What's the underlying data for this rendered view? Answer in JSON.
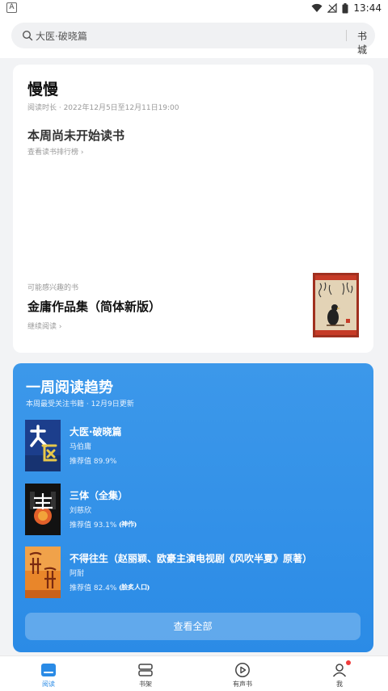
{
  "status_bar": {
    "time": "13:44",
    "left_indicator": "A"
  },
  "search": {
    "placeholder_text": "大医·破晓篇",
    "bookstore_label": "书城"
  },
  "profile": {
    "name": "慢慢",
    "reading_period": "阅读时长 · 2022年12月5日至12月11日19:00",
    "week_status": "本周尚未开始读书",
    "rank_link": "查看读书排行榜 ›"
  },
  "suggestion": {
    "label": "可能感兴趣的书",
    "title": "金庸作品集（简体新版）",
    "continue_label": "继续阅读 ›"
  },
  "trend": {
    "title": "一周阅读趋势",
    "subtitle": "本周最受关注书籍 · 12月9日更新",
    "books": [
      {
        "title": "大医·破晓篇",
        "author": "马伯庸",
        "score": "推荐值 89.9%",
        "badge": ""
      },
      {
        "title": "三体（全集）",
        "author": "刘慈欣",
        "score": "推荐值 93.1%",
        "badge": "神作"
      },
      {
        "title": "不得往生（赵丽颖、欧豪主演电视剧《风吹半夏》原著）",
        "author": "阿耐",
        "score": "推荐值 82.4%",
        "badge": "脍炙人口"
      }
    ],
    "view_all_label": "查看全部"
  },
  "nav": {
    "items": [
      {
        "label": "阅读",
        "active": true
      },
      {
        "label": "书架",
        "active": false
      },
      {
        "label": "有声书",
        "active": false
      },
      {
        "label": "我",
        "active": false
      }
    ]
  },
  "colors": {
    "accent": "#2a8be6",
    "card_blue": "#3c98ea",
    "notification": "#f03c3c"
  }
}
